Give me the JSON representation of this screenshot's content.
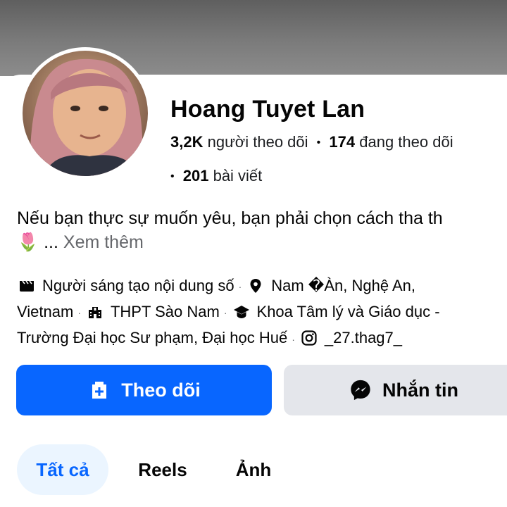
{
  "profile": {
    "name": "Hoang Tuyet Lan",
    "followers_count": "3,2K",
    "followers_label": "người theo dõi",
    "following_count": "174",
    "following_label": "đang theo dõi",
    "posts_count": "201",
    "posts_label": "bài viết",
    "separator": "•"
  },
  "bio": {
    "line1": "Nếu bạn thực sự muốn yêu, bạn phải chọn cách tha th",
    "emoji": "🌷",
    "ellipsis": "...",
    "see_more": "Xem thêm"
  },
  "details": {
    "creator": "Người sáng tạo nội dung số",
    "location": "Nam �Àn, Nghệ An,",
    "location_cont": "Vietnam",
    "school": "THPT Sào Nam",
    "university": "Khoa Tâm lý và Giáo dục -",
    "university_cont": "Trường Đại học Sư phạm, Đại học Huế",
    "instagram": "_27.thag7_",
    "dot": "·"
  },
  "actions": {
    "follow_label": "Theo dõi",
    "message_label": "Nhắn tin"
  },
  "tabs": [
    {
      "label": "Tất cả",
      "active": true
    },
    {
      "label": "Reels",
      "active": false
    },
    {
      "label": "Ảnh",
      "active": false
    }
  ],
  "icons": {
    "creator": "clapperboard-icon",
    "location": "map-pin-icon",
    "school": "school-building-icon",
    "university": "graduation-cap-icon",
    "instagram": "instagram-icon",
    "follow": "add-friend-icon",
    "message": "messenger-icon"
  },
  "colors": {
    "primary": "#0866ff",
    "secondary_button": "#e4e6eb",
    "active_tab_bg": "#ebf5ff",
    "muted_text": "#65676b"
  }
}
